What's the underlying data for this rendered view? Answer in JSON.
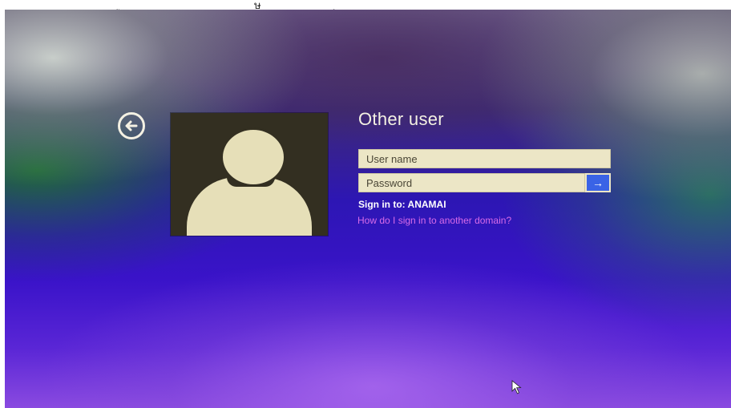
{
  "top_caption": "ู                                    ษ                    ุ",
  "login": {
    "title": "Other user",
    "username_placeholder": "User name",
    "password_placeholder": "Password",
    "sign_in_to": "Sign in to: ANAMAI",
    "other_domain_link": "How do I sign in to another domain?",
    "submit_glyph": "→"
  },
  "icons": {
    "back": "back-arrow-circle-icon",
    "avatar": "user-silhouette-icon",
    "submit": "arrow-right-icon",
    "cursor": "mouse-pointer-icon"
  },
  "colors": {
    "text": "#f4f1e3",
    "field_bg": "#ece6c6",
    "submit_bg": "#3a63e6",
    "link": "#d86be8",
    "avatar_bg": "#332f21",
    "avatar_fg": "#e6dfb8"
  }
}
